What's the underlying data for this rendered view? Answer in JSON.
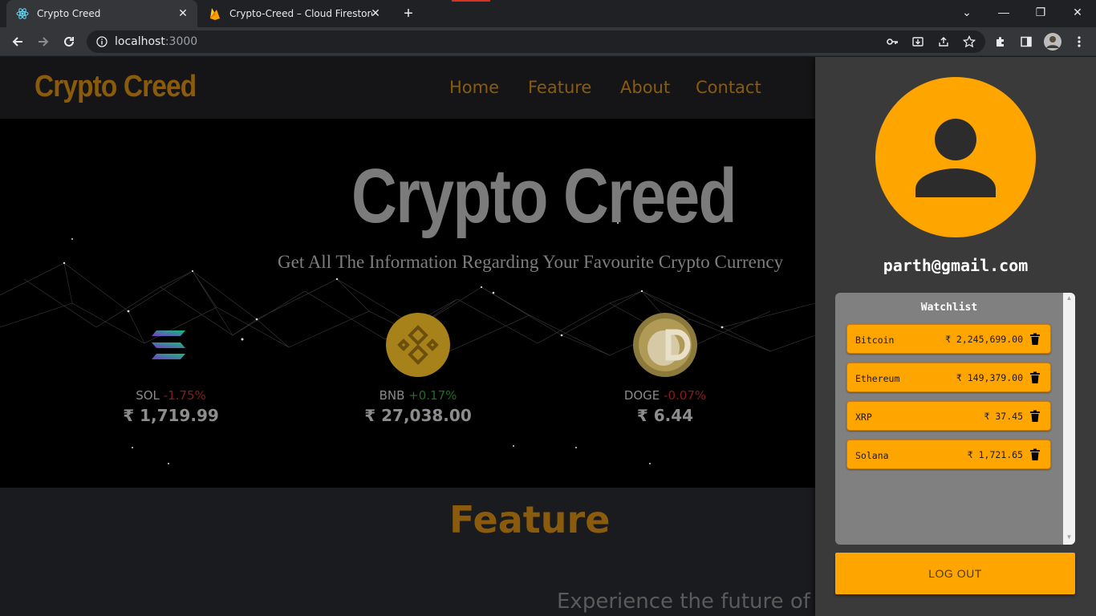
{
  "browser": {
    "tabs": [
      {
        "title": "Crypto Creed",
        "active": true,
        "icon": "react-icon"
      },
      {
        "title": "Crypto-Creed – Cloud Firestore –",
        "active": false,
        "icon": "firebase-icon"
      }
    ],
    "url_host": "localhost",
    "url_port": ":3000"
  },
  "site": {
    "logo": "Crypto Creed",
    "nav": [
      "Home",
      "Feature",
      "About",
      "Contact"
    ],
    "hero_title": "Crypto Creed",
    "hero_subtitle": "Get All The Information Regarding Your Favourite Crypto Currency",
    "coins": [
      {
        "symbol": "SOL",
        "change": "-1.75%",
        "direction": "down",
        "price": "₹ 1,719.99"
      },
      {
        "symbol": "BNB",
        "change": "+0.17%",
        "direction": "up",
        "price": "₹ 27,038.00"
      },
      {
        "symbol": "DOGE",
        "change": "-0.07%",
        "direction": "down",
        "price": "₹ 6.44"
      }
    ],
    "feature_title": "Feature",
    "feature_subtitle": "Experience the future of f"
  },
  "panel": {
    "email": "parth@gmail.com",
    "watchlist_title": "Watchlist",
    "watchlist": [
      {
        "name": "Bitcoin",
        "price": "₹ 2,245,699.00"
      },
      {
        "name": "Ethereum",
        "price": "₹ 149,379.00"
      },
      {
        "name": "XRP",
        "price": "₹ 37.45"
      },
      {
        "name": "Solana",
        "price": "₹ 1,721.65"
      }
    ],
    "logout_label": "LOG OUT"
  },
  "colors": {
    "accent": "#ffa500",
    "brand_dim": "#8a5b0c",
    "negative": "#8b1a1a",
    "positive": "#1f6e1f"
  }
}
